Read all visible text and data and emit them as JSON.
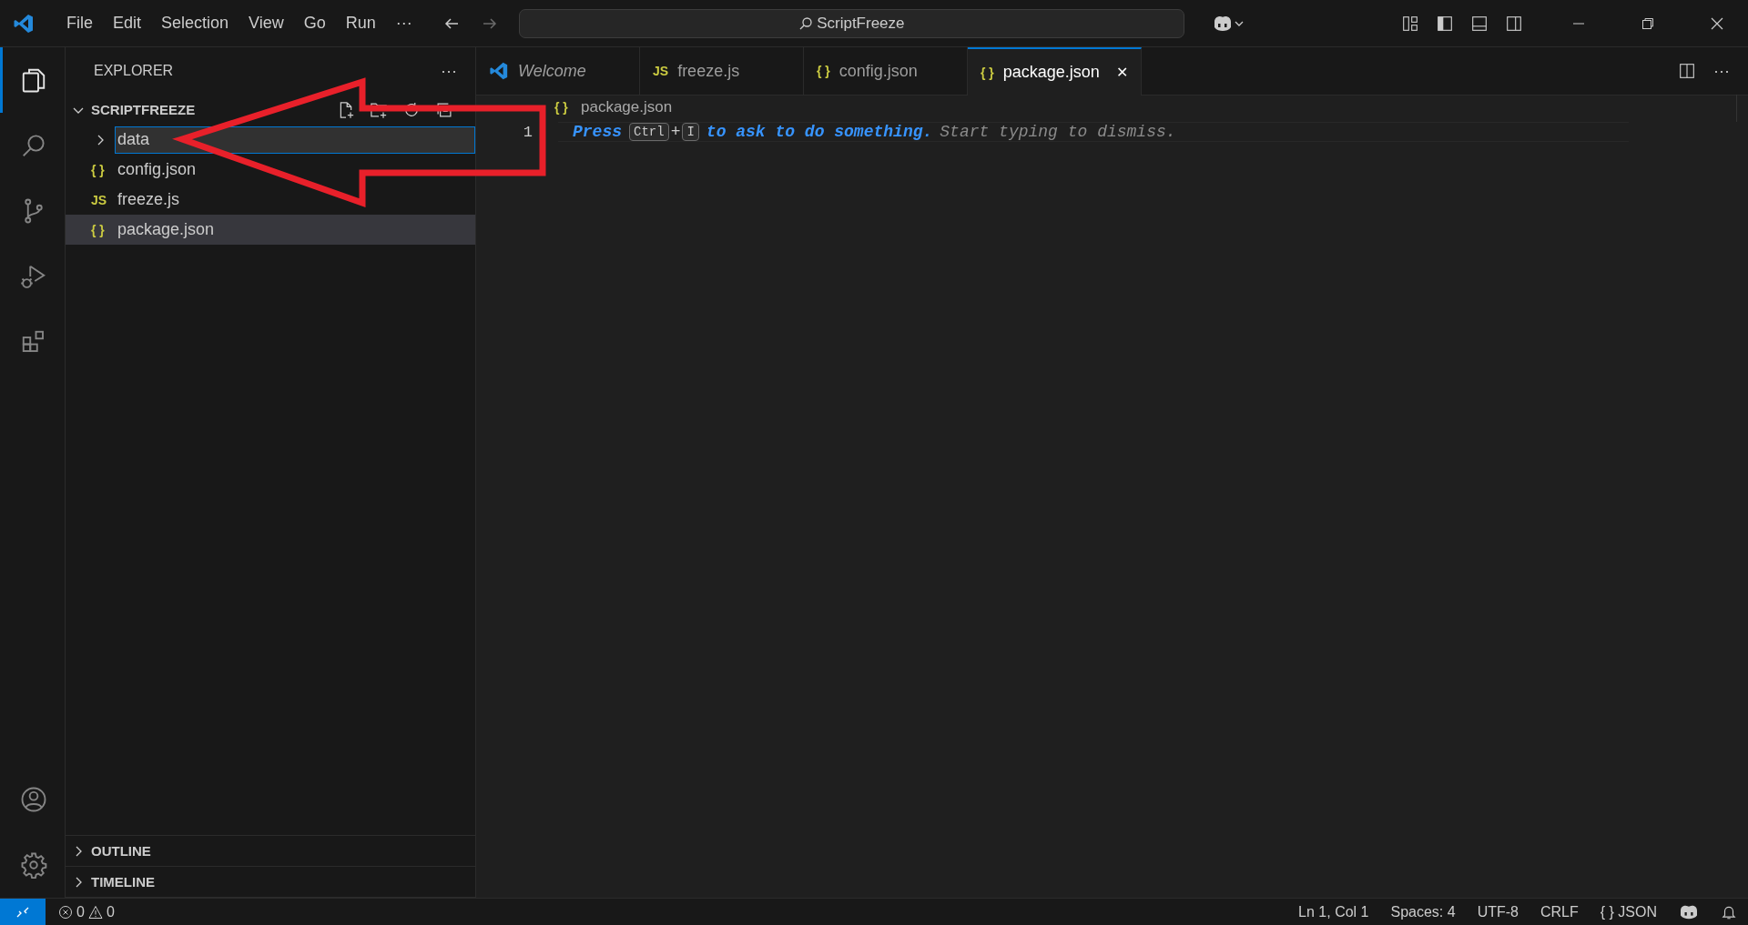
{
  "menu": [
    "File",
    "Edit",
    "Selection",
    "View",
    "Go",
    "Run"
  ],
  "menu_more": "···",
  "nav": {
    "back_disabled": false,
    "forward_disabled": true
  },
  "command_center": "ScriptFreeze",
  "sidebar": {
    "title": "EXPLORER",
    "more": "···",
    "root": {
      "label": "SCRIPTFREEZE",
      "expanded": true,
      "children": [
        {
          "kind": "folder",
          "label": "data",
          "expanded": false,
          "renaming": true,
          "selected": false
        },
        {
          "kind": "file",
          "icon_text": "{ }",
          "label": "config.json",
          "selected": false
        },
        {
          "kind": "file",
          "icon_text": "JS",
          "label": "freeze.js",
          "selected": false
        },
        {
          "kind": "file",
          "icon_text": "{ }",
          "label": "package.json",
          "selected": true
        }
      ]
    },
    "sections": [
      {
        "label": "OUTLINE",
        "expanded": false
      },
      {
        "label": "TIMELINE",
        "expanded": false
      }
    ]
  },
  "tabs": [
    {
      "kind": "preview",
      "label": "Welcome",
      "selected": false
    },
    {
      "kind": "file",
      "icon_text": "JS",
      "label": "freeze.js",
      "selected": false
    },
    {
      "kind": "file",
      "icon_text": "{ }",
      "label": "config.json",
      "selected": false
    },
    {
      "kind": "file",
      "icon_text": "{ }",
      "label": "package.json",
      "selected": true,
      "close": "✕"
    }
  ],
  "breadcrumb": {
    "icon_text": "{ }",
    "label": "package.json"
  },
  "editor": {
    "line_number": "1",
    "hint": [
      {
        "kind": "word",
        "text": "Press"
      },
      {
        "kind": "key",
        "text": "Ctrl"
      },
      {
        "kind": "plus",
        "text": "+"
      },
      {
        "kind": "key",
        "text": "I"
      },
      {
        "kind": "word",
        "text": "to ask to do something."
      },
      {
        "kind": "muted",
        "text": "Start typing to dismiss."
      }
    ]
  },
  "status_bar": {
    "errors": "0",
    "warnings": "0",
    "right": [
      {
        "kind": "text",
        "text": "Ln 1, Col 1"
      },
      {
        "kind": "text",
        "text": "Spaces: 4"
      },
      {
        "kind": "text",
        "text": "UTF-8"
      },
      {
        "kind": "text",
        "text": "CRLF"
      },
      {
        "kind": "language",
        "icon_text": "{ }",
        "text": "JSON"
      }
    ]
  }
}
